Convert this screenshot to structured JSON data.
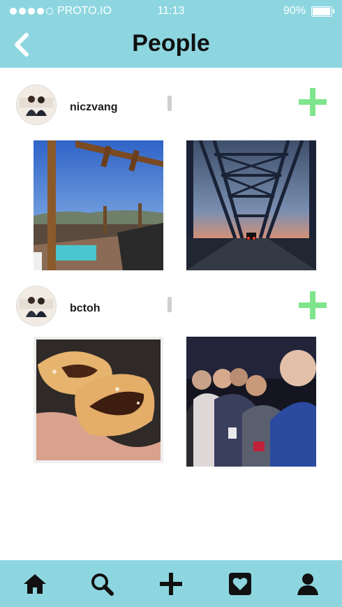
{
  "status_bar": {
    "carrier": "PROTO.IO",
    "time": "11:13",
    "battery": "90%",
    "battery_level": 0.9,
    "signal_bars_filled": 4,
    "signal_bars_total": 5
  },
  "nav": {
    "title": "People"
  },
  "posts": [
    {
      "username": "niczvang"
    },
    {
      "username": "bctoh"
    }
  ],
  "tabs": [
    "home",
    "search",
    "add",
    "activity",
    "profile"
  ],
  "colors": {
    "accent": "#8dd6e0",
    "follow_green": "#7fe58c",
    "icon_dark": "#111111"
  }
}
